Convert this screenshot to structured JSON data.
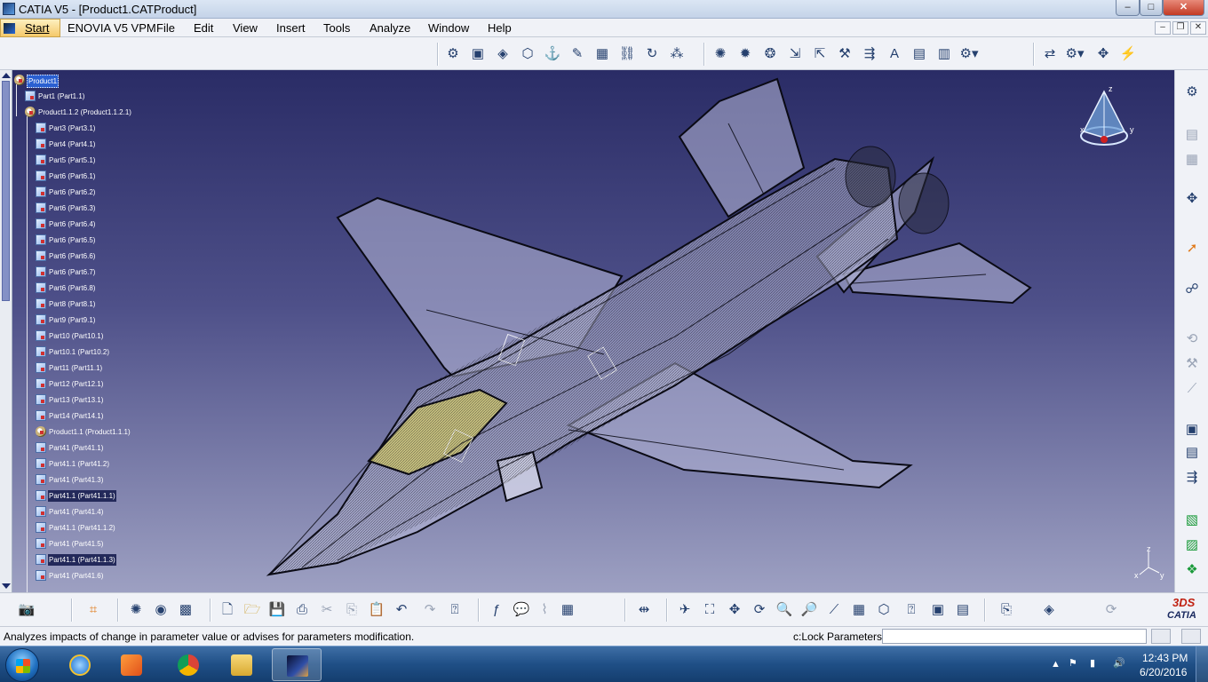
{
  "window": {
    "title": "CATIA V5 - [Product1.CATProduct]",
    "controls": {
      "minimize": "–",
      "maximize": "□",
      "close": "✕"
    }
  },
  "menu": {
    "items": [
      "Start",
      "ENOVIA V5 VPM",
      "File",
      "Edit",
      "View",
      "Insert",
      "Tools",
      "Analyze",
      "Window",
      "Help"
    ],
    "mdi_controls": {
      "minimize": "–",
      "restore": "❐",
      "close": "✕"
    }
  },
  "toolbar_top": {
    "groups": [
      {
        "name": "product-structure",
        "icons": [
          "insert-component-icon",
          "new-product-icon",
          "new-part-icon",
          "existing-component-icon",
          "replace-component-icon",
          "graph-tree-icon",
          "generate-numbering-icon",
          "selective-load-icon",
          "manage-representations-icon",
          "multi-instantiation-icon"
        ]
      },
      {
        "name": "constraints",
        "icons": [
          "coincidence-icon",
          "contact-icon",
          "offset-icon",
          "angle-icon",
          "fix-icon",
          "fix-together-icon",
          "quick-constraint-icon",
          "flexible-rigid-icon",
          "change-constraint-icon",
          "reuse-pattern-icon"
        ]
      },
      {
        "name": "move",
        "icons": [
          "manipulate-icon",
          "snap-icon",
          "explode-icon",
          "stop-manipulate-icon"
        ]
      }
    ]
  },
  "tree": {
    "root": "Product1",
    "nodes": [
      {
        "label": "Part1 (Part1.1)",
        "level": 1,
        "kind": "part"
      },
      {
        "label": "Product1.1.2 (Product1.1.2.1)",
        "level": 1,
        "kind": "product"
      },
      {
        "label": "Part3 (Part3.1)",
        "level": 2,
        "kind": "part"
      },
      {
        "label": "Part4 (Part4.1)",
        "level": 2,
        "kind": "part"
      },
      {
        "label": "Part5 (Part5.1)",
        "level": 2,
        "kind": "part"
      },
      {
        "label": "Part6 (Part6.1)",
        "level": 2,
        "kind": "part"
      },
      {
        "label": "Part6 (Part6.2)",
        "level": 2,
        "kind": "part"
      },
      {
        "label": "Part6 (Part6.3)",
        "level": 2,
        "kind": "part"
      },
      {
        "label": "Part6 (Part6.4)",
        "level": 2,
        "kind": "part"
      },
      {
        "label": "Part6 (Part6.5)",
        "level": 2,
        "kind": "part"
      },
      {
        "label": "Part6 (Part6.6)",
        "level": 2,
        "kind": "part"
      },
      {
        "label": "Part6 (Part6.7)",
        "level": 2,
        "kind": "part"
      },
      {
        "label": "Part6 (Part6.8)",
        "level": 2,
        "kind": "part"
      },
      {
        "label": "Part8 (Part8.1)",
        "level": 2,
        "kind": "part"
      },
      {
        "label": "Part9 (Part9.1)",
        "level": 2,
        "kind": "part"
      },
      {
        "label": "Part10 (Part10.1)",
        "level": 2,
        "kind": "part"
      },
      {
        "label": "Part10.1 (Part10.2)",
        "level": 2,
        "kind": "part"
      },
      {
        "label": "Part11 (Part11.1)",
        "level": 2,
        "kind": "part"
      },
      {
        "label": "Part12 (Part12.1)",
        "level": 2,
        "kind": "part"
      },
      {
        "label": "Part13 (Part13.1)",
        "level": 2,
        "kind": "part"
      },
      {
        "label": "Part14 (Part14.1)",
        "level": 2,
        "kind": "part"
      },
      {
        "label": "Product1.1 (Product1.1.1)",
        "level": 2,
        "kind": "product"
      },
      {
        "label": "Part41 (Part41.1)",
        "level": 2,
        "kind": "part"
      },
      {
        "label": "Part41.1 (Part41.2)",
        "level": 2,
        "kind": "part"
      },
      {
        "label": "Part41 (Part41.3)",
        "level": 2,
        "kind": "part"
      },
      {
        "label": "Part41.1 (Part41.1.1)",
        "level": 2,
        "kind": "part",
        "selected": true
      },
      {
        "label": "Part41 (Part41.4)",
        "level": 2,
        "kind": "part"
      },
      {
        "label": "Part41.1 (Part41.1.2)",
        "level": 2,
        "kind": "part"
      },
      {
        "label": "Part41 (Part41.5)",
        "level": 2,
        "kind": "part"
      },
      {
        "label": "Part41.1 (Part41.1.3)",
        "level": 2,
        "kind": "part",
        "selected": true
      },
      {
        "label": "Part41 (Part41.6)",
        "level": 2,
        "kind": "part"
      }
    ]
  },
  "compass": {
    "axis_z": "z",
    "axis_x": "x",
    "axis_y": "y"
  },
  "axes_small": {
    "z": "z",
    "x": "x",
    "y": "y"
  },
  "toolbar_right": {
    "icons": [
      "sketcher-icon",
      "3d-annotation-icon",
      "annotation-view-icon",
      "scene-icon",
      "select-icon",
      "clash-icon",
      "sectioning-icon",
      "distance-band-icon",
      "measure-between-icon",
      "measure-item-icon",
      "bill-of-material-icon",
      "scenes-icon",
      "catalog-browser-icon",
      "save-management-icon"
    ]
  },
  "toolbar_bottom": {
    "icons": [
      "capture-icon",
      "constraint-icon",
      "render-style-icon",
      "material-icon",
      "apply-material-icon",
      "new-icon",
      "open-icon",
      "save-icon",
      "print-icon",
      "cut-icon",
      "copy-icon",
      "paste-icon",
      "undo-icon",
      "redo-icon",
      "whats-this-icon",
      "formula-icon",
      "comment-icon",
      "design-table-icon",
      "table-icon",
      "catalog-icon",
      "fly-mode-icon",
      "fit-all-icon",
      "pan-icon",
      "rotate-icon",
      "zoom-in-icon",
      "zoom-out-icon",
      "normal-view-icon",
      "multi-view-icon",
      "isometric-view-icon",
      "shading-icon",
      "hide-show-icon",
      "swap-visible-icon",
      "apply-customization-icon",
      "update-icon"
    ]
  },
  "catia_logo": {
    "ds": "3DS",
    "name": "CATIA"
  },
  "status": {
    "message": "Analyzes impacts of change in parameter value or advises for parameters modification.",
    "command_label": "c:Lock Parameters",
    "command_value": ""
  },
  "taskbar": {
    "apps": [
      "internet-explorer-icon",
      "media-player-icon",
      "chrome-icon",
      "file-explorer-icon",
      "catia-icon"
    ],
    "active_app": "catia-icon",
    "time": "12:43 PM",
    "date": "6/20/2016"
  },
  "colors": {
    "viewport_top": "#2a2c66",
    "viewport_bottom": "#9da0c2",
    "selection": "#2a5fd1",
    "wireframe": "#0a0a14",
    "canopy": "#d8cf6a"
  }
}
